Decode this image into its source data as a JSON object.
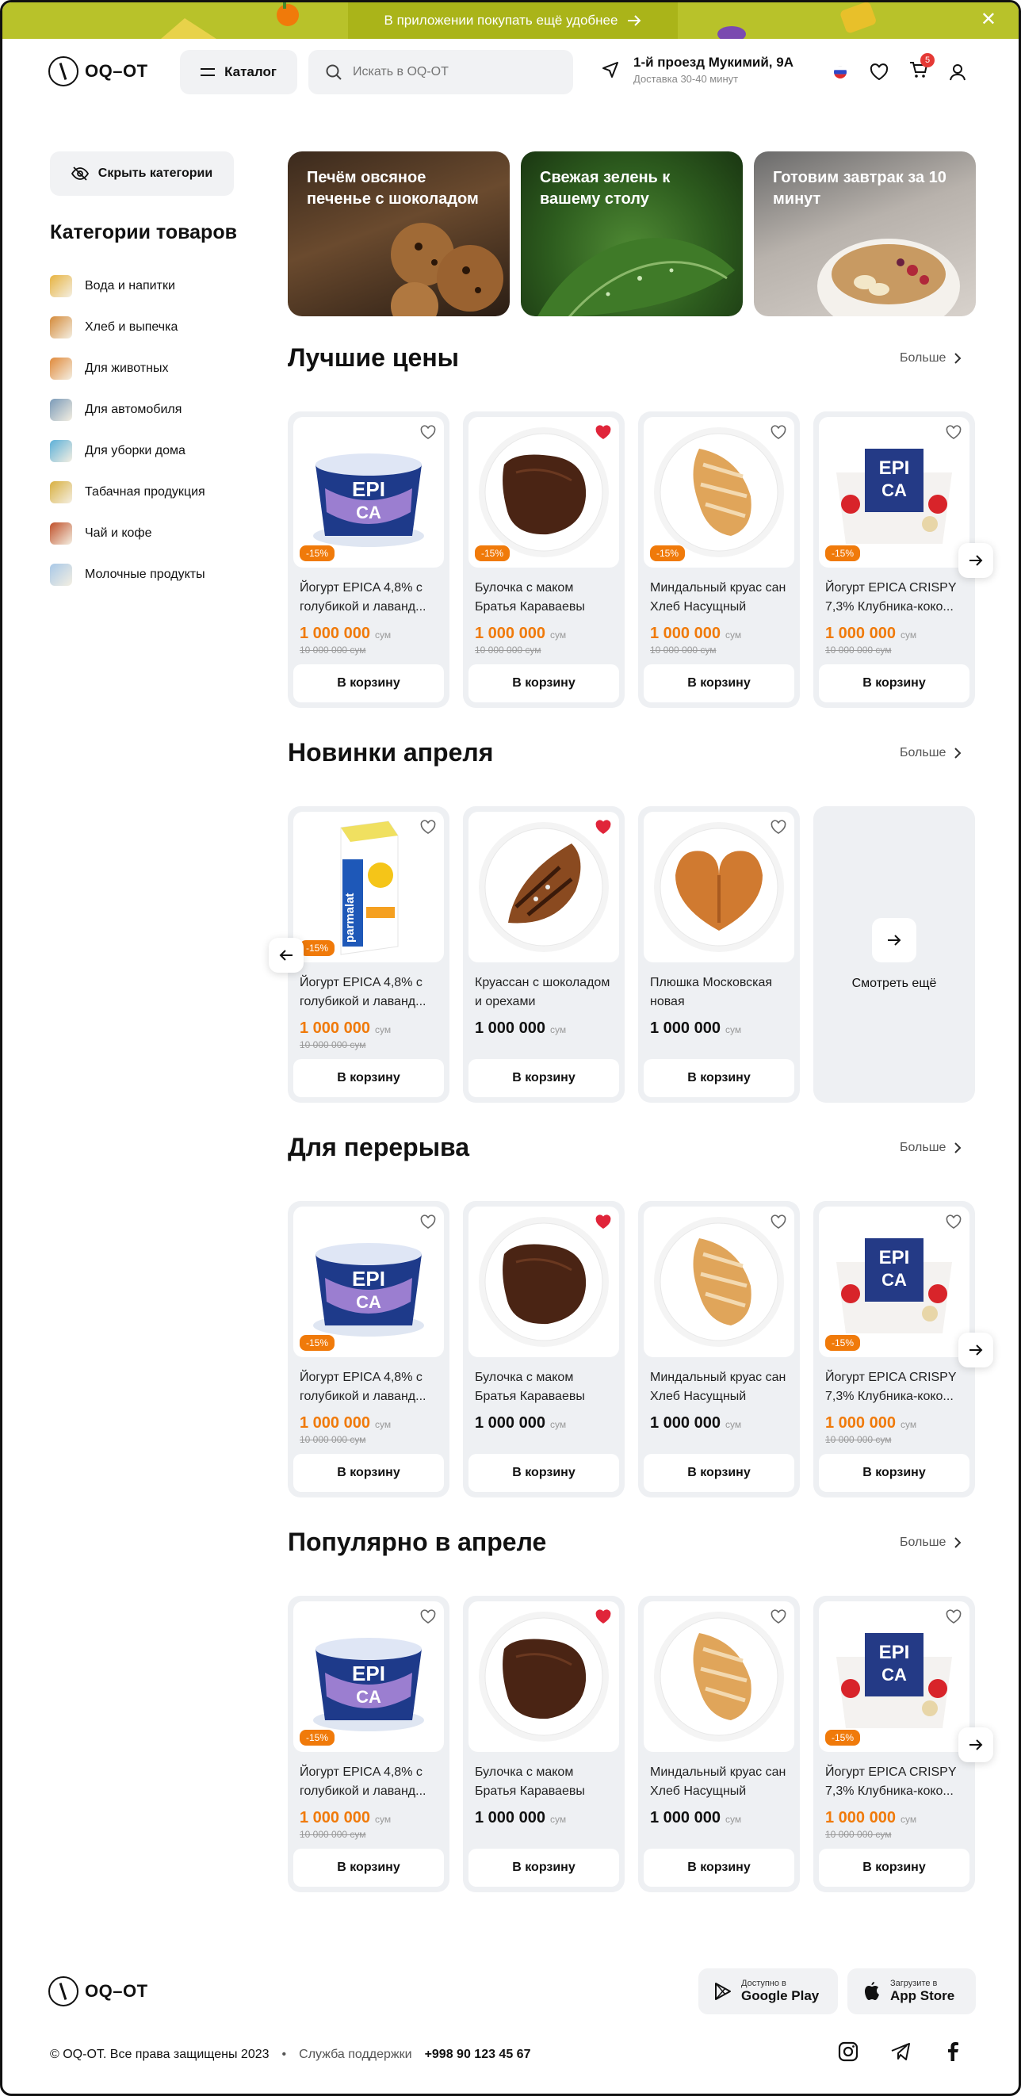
{
  "promo": {
    "text": "В приложении покупать ещё удобнее",
    "colors": {
      "bar": "#b8c22a",
      "accent": "#f07a0a"
    }
  },
  "header": {
    "logo": "OQ–OT",
    "catalog_label": "Каталог",
    "search_placeholder": "Искать в OQ-OT",
    "address": "1-й проезд Мукимий, 9А",
    "delivery": "Доставка 30-40 минут",
    "cart_count": "5"
  },
  "sidebar": {
    "hide_label": "Скрыть категории",
    "title": "Категории товаров",
    "items": [
      {
        "label": "Вода и напитки",
        "icon": "drinks-icon"
      },
      {
        "label": "Хлеб и выпечка",
        "icon": "bread-icon"
      },
      {
        "label": "Для животных",
        "icon": "pets-icon"
      },
      {
        "label": "Для автомобиля",
        "icon": "car-icon"
      },
      {
        "label": "Для уборки дома",
        "icon": "cleaning-icon"
      },
      {
        "label": "Табачная продукция",
        "icon": "tobacco-icon"
      },
      {
        "label": "Чай и кофе",
        "icon": "tea-icon"
      },
      {
        "label": "Молочные продукты",
        "icon": "dairy-icon"
      }
    ]
  },
  "banners": [
    {
      "text": "Печём овсяное печенье с шоколадом"
    },
    {
      "text": "Свежая зелень к вашему столу"
    },
    {
      "text": "Готовим завтрак за 10 минут"
    }
  ],
  "more_label": "Больше",
  "currency": "сум",
  "cart_label": "В корзину",
  "see_more": "Смотреть ещё",
  "sections": [
    {
      "title": "Лучшие цены",
      "products": [
        {
          "name": "Йогурт EPICA 4,8% с голубикой и лаванд...",
          "price": "1 000 000",
          "old": "10 000 000 сум",
          "discount": "-15%",
          "fav": false,
          "kind": "yogurt"
        },
        {
          "name": "Булочка с маком Братья Караваевы",
          "price": "1 000 000",
          "old": "10 000 000 сум",
          "discount": "-15%",
          "fav": true,
          "kind": "bun"
        },
        {
          "name": "Миндальный круас сан Хлеб Насущный",
          "price": "1 000 000",
          "old": "10 000 000 сум",
          "discount": "-15%",
          "fav": false,
          "kind": "croissant"
        },
        {
          "name": "Йогурт EPICA CRISPY 7,3% Клубника-коко...",
          "price": "1 000 000",
          "old": "10 000 000 сум",
          "discount": "-15%",
          "fav": false,
          "kind": "crispy"
        }
      ]
    },
    {
      "title": "Новинки апреля",
      "products": [
        {
          "name": "Йогурт EPICA 4,8% с голубикой и лаванд...",
          "price": "1 000 000",
          "old": "10 000 000 сум",
          "discount": "-15%",
          "fav": false,
          "kind": "milk"
        },
        {
          "name": "Круассан с шоколадом и орехами",
          "price": "1 000 000",
          "old": "",
          "discount": "",
          "fav": true,
          "kind": "chococroissant"
        },
        {
          "name": "Плюшка Московская новая",
          "price": "1 000 000",
          "old": "",
          "discount": "",
          "fav": false,
          "kind": "plushka"
        }
      ]
    },
    {
      "title": "Для перерыва",
      "products": [
        {
          "name": "Йогурт EPICA 4,8% с голубикой и лаванд...",
          "price": "1 000 000",
          "old": "10 000 000 сум",
          "discount": "-15%",
          "fav": false,
          "kind": "yogurt"
        },
        {
          "name": "Булочка с маком Братья Караваевы",
          "price": "1 000 000",
          "old": "",
          "discount": "",
          "fav": true,
          "kind": "bun"
        },
        {
          "name": "Миндальный круас сан Хлеб Насущный",
          "price": "1 000 000",
          "old": "",
          "discount": "",
          "fav": false,
          "kind": "croissant"
        },
        {
          "name": "Йогурт EPICA CRISPY 7,3% Клубника-коко...",
          "price": "1 000 000",
          "old": "10 000 000 сум",
          "discount": "-15%",
          "fav": false,
          "kind": "crispy"
        }
      ]
    },
    {
      "title": "Популярно в апреле",
      "products": [
        {
          "name": "Йогурт EPICA 4,8% с голубикой и лаванд...",
          "price": "1 000 000",
          "old": "10 000 000 сум",
          "discount": "-15%",
          "fav": false,
          "kind": "yogurt"
        },
        {
          "name": "Булочка с маком Братья Караваевы",
          "price": "1 000 000",
          "old": "",
          "discount": "",
          "fav": true,
          "kind": "bun"
        },
        {
          "name": "Миндальный круас сан Хлеб Насущный",
          "price": "1 000 000",
          "old": "",
          "discount": "",
          "fav": false,
          "kind": "croissant"
        },
        {
          "name": "Йогурт EPICA CRISPY 7,3% Клубника-коко...",
          "price": "1 000 000",
          "old": "10 000 000 сум",
          "discount": "-15%",
          "fav": false,
          "kind": "crispy"
        }
      ]
    }
  ],
  "footer": {
    "logo": "OQ–OT",
    "google_small": "Доступно в",
    "google_big": "Google Play",
    "apple_small": "Загрузите в",
    "apple_big": "App Store",
    "copyright": "© OQ-OT. Все права защищены 2023",
    "support": "Служба поддержки",
    "phone": "+998 90 123 45 67"
  }
}
